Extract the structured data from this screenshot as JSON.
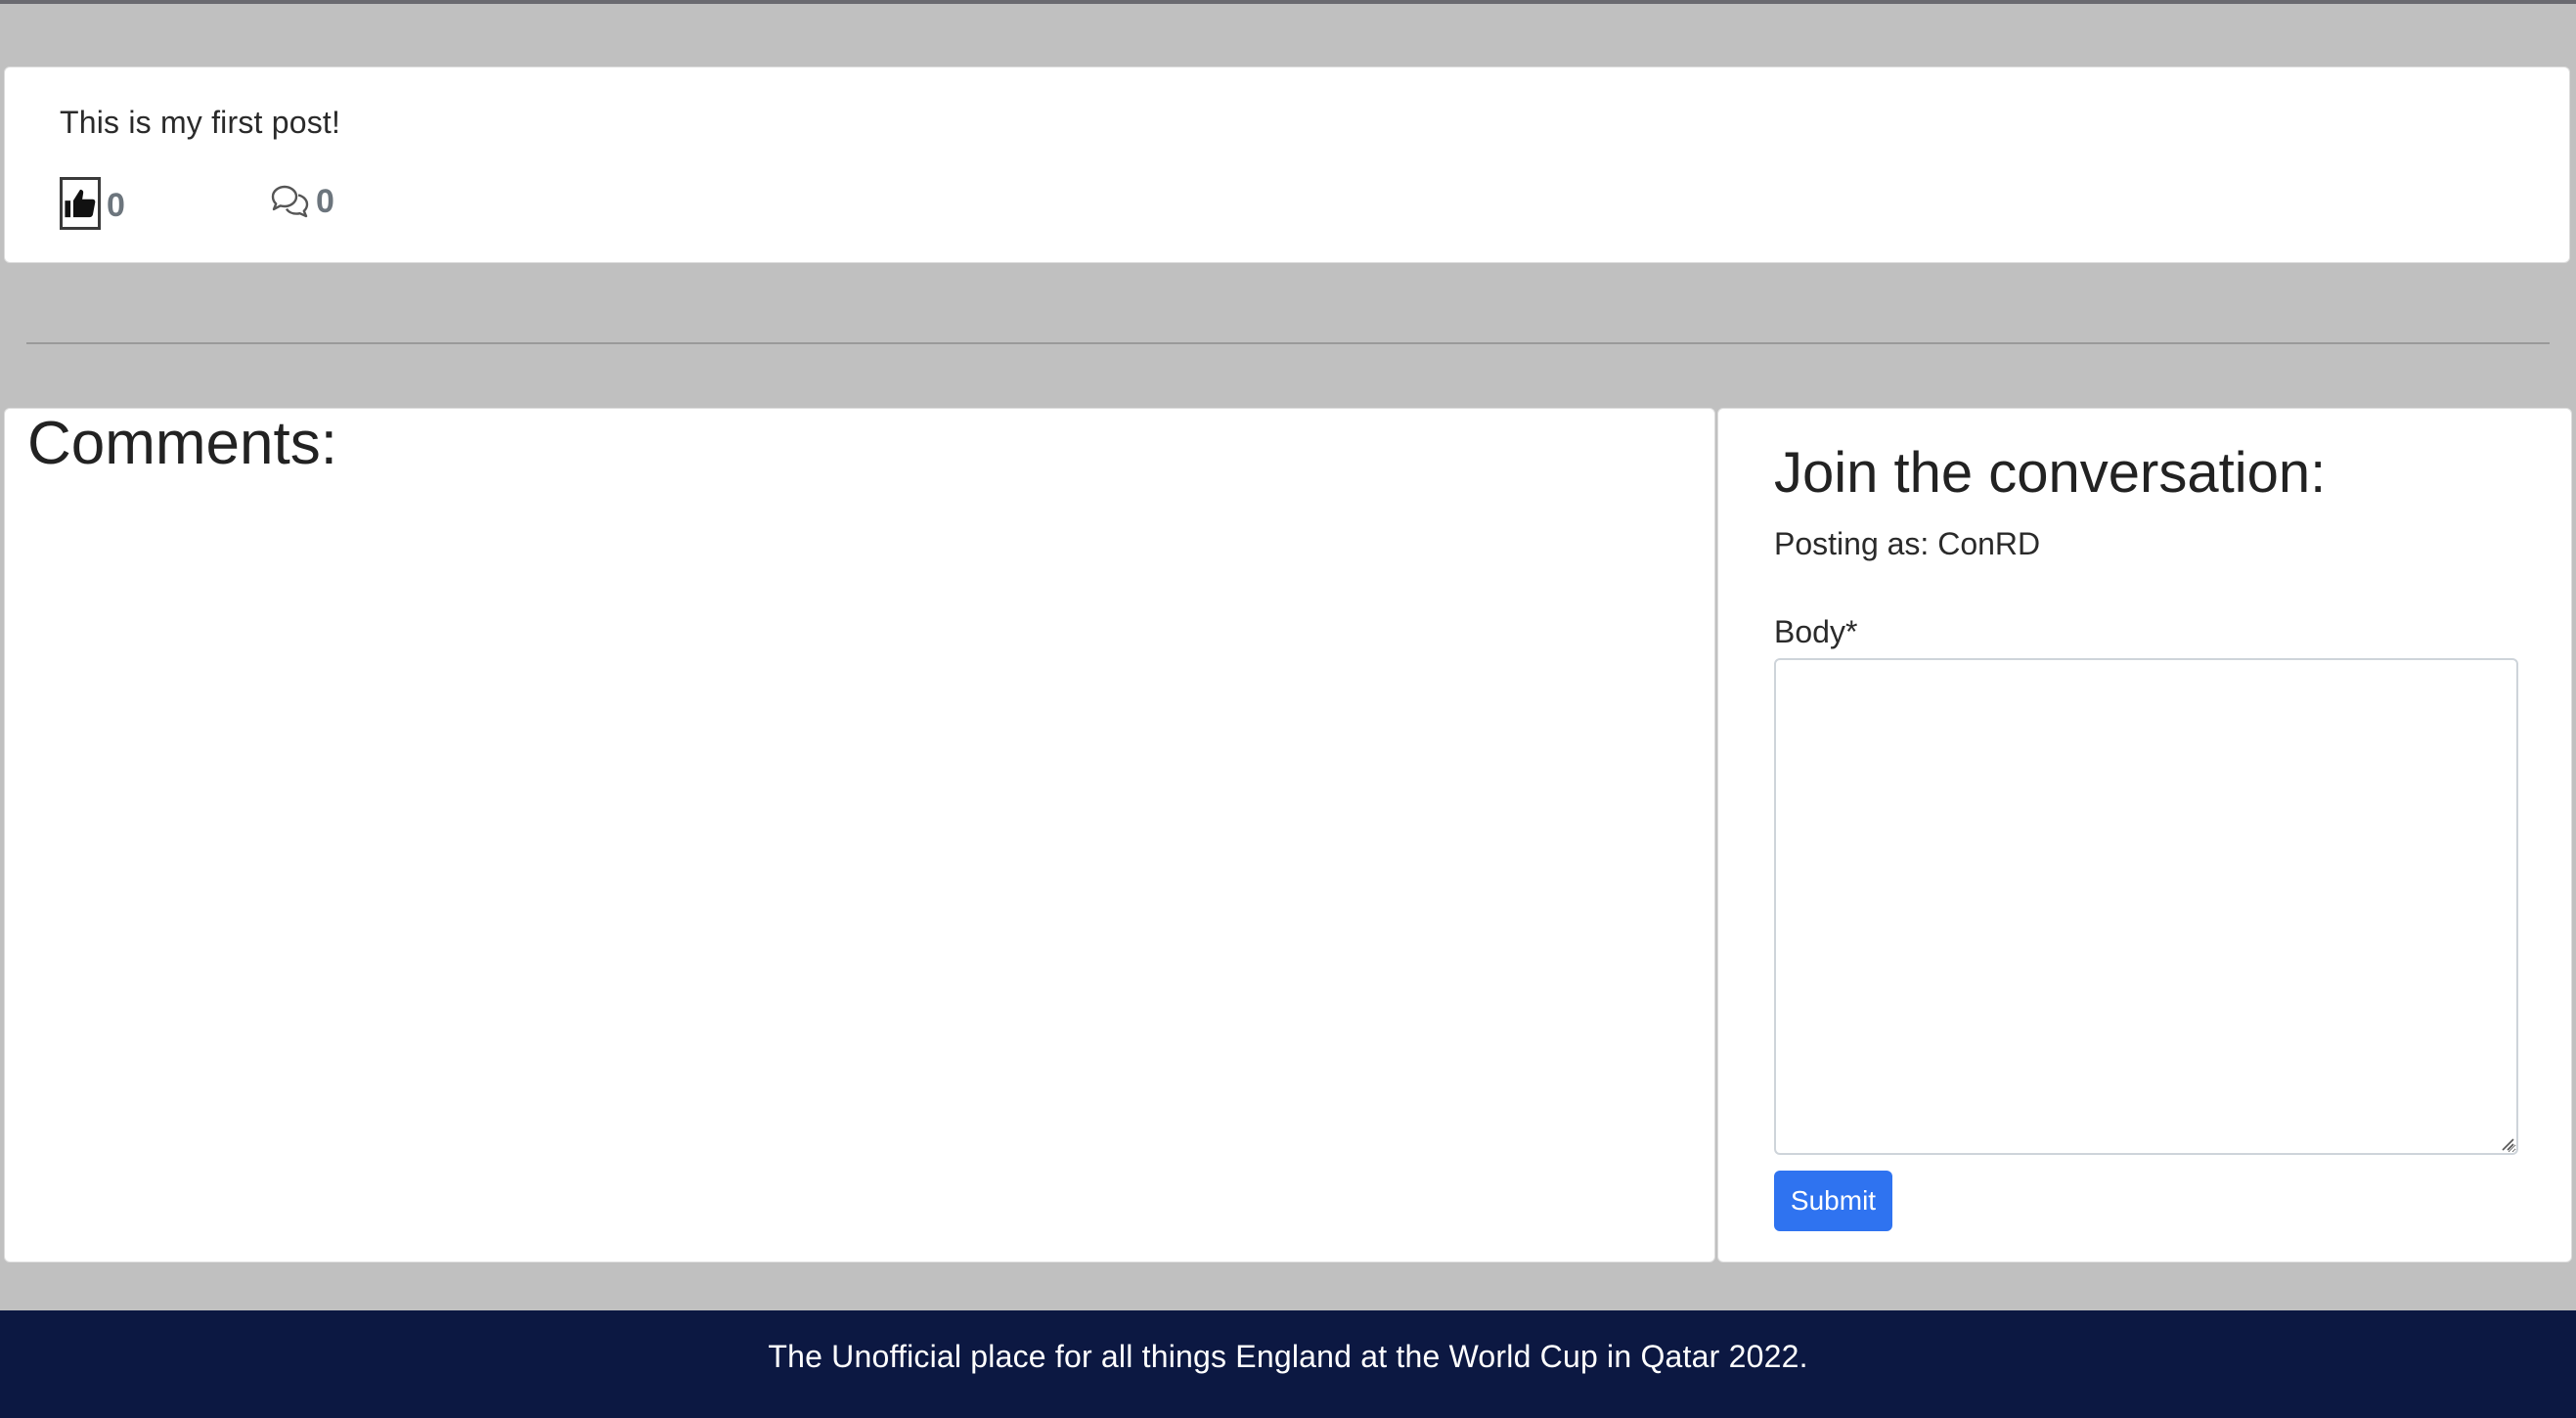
{
  "post": {
    "body": "This is my first post!",
    "like_icon": "thumbs-up-icon",
    "like_count": "0",
    "comment_icon": "chat-bubbles-icon",
    "comment_count": "0"
  },
  "comments": {
    "title": "Comments:"
  },
  "form": {
    "title": "Join the conversation:",
    "posting_as": "Posting as: ConRD",
    "body_label": "Body*",
    "body_value": "",
    "submit_label": "Submit"
  },
  "footer": {
    "text": "The Unofficial place for all things England at the World Cup in Qatar 2022."
  },
  "colors": {
    "page_background": "#c0c0c0",
    "card_background": "#ffffff",
    "submit_button": "#2f73f0",
    "footer_background": "#0c1842",
    "count_text": "#6c757d"
  }
}
